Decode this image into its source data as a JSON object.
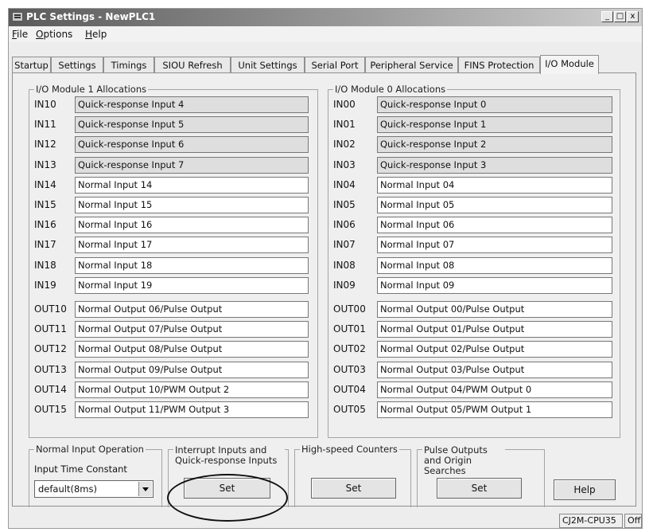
{
  "window": {
    "title": "PLC Settings - NewPLC1"
  },
  "menu": [
    "File",
    "Options",
    "Help"
  ],
  "tabs": [
    "Startup",
    "Settings",
    "Timings",
    "SIOU Refresh",
    "Unit Settings",
    "Serial Port",
    "Peripheral Service",
    "FINS Protection",
    "I/O Module"
  ],
  "module1": {
    "title": "I/O Module 1 Allocations",
    "inputs": [
      {
        "label": "IN10",
        "value": "Quick-response Input 4"
      },
      {
        "label": "IN11",
        "value": "Quick-response Input 5"
      },
      {
        "label": "IN12",
        "value": "Quick-response Input 6"
      },
      {
        "label": "IN13",
        "value": "Quick-response Input 7"
      },
      {
        "label": "IN14",
        "value": "Normal Input 14"
      },
      {
        "label": "IN15",
        "value": "Normal Input 15"
      },
      {
        "label": "IN16",
        "value": "Normal Input 16"
      },
      {
        "label": "IN17",
        "value": "Normal Input 17"
      },
      {
        "label": "IN18",
        "value": "Normal Input 18"
      },
      {
        "label": "IN19",
        "value": "Normal Input 19"
      }
    ],
    "outputs": [
      {
        "label": "OUT10",
        "value": "Normal Output 06/Pulse Output"
      },
      {
        "label": "OUT11",
        "value": "Normal Output 07/Pulse Output"
      },
      {
        "label": "OUT12",
        "value": "Normal Output 08/Pulse Output"
      },
      {
        "label": "OUT13",
        "value": "Normal Output 09/Pulse Output"
      },
      {
        "label": "OUT14",
        "value": "Normal Output 10/PWM Output 2"
      },
      {
        "label": "OUT15",
        "value": "Normal Output 11/PWM Output 3"
      }
    ]
  },
  "module0": {
    "title": "I/O Module 0 Allocations",
    "inputs": [
      {
        "label": "IN00",
        "value": "Quick-response Input 0"
      },
      {
        "label": "IN01",
        "value": "Quick-response Input 1"
      },
      {
        "label": "IN02",
        "value": "Quick-response Input 2"
      },
      {
        "label": "IN03",
        "value": "Quick-response Input 3"
      },
      {
        "label": "IN04",
        "value": "Normal Input 04"
      },
      {
        "label": "IN05",
        "value": "Normal Input 05"
      },
      {
        "label": "IN06",
        "value": "Normal Input 06"
      },
      {
        "label": "IN07",
        "value": "Normal Input 07"
      },
      {
        "label": "IN08",
        "value": "Normal Input 08"
      },
      {
        "label": "IN09",
        "value": "Normal Input 09"
      }
    ],
    "outputs": [
      {
        "label": "OUT00",
        "value": "Normal Output 00/Pulse Output"
      },
      {
        "label": "OUT01",
        "value": "Normal Output 01/Pulse Output"
      },
      {
        "label": "OUT02",
        "value": "Normal Output 02/Pulse Output"
      },
      {
        "label": "OUT03",
        "value": "Normal Output 03/Pulse Output"
      },
      {
        "label": "OUT04",
        "value": "Normal Output 04/PWM Output 0"
      },
      {
        "label": "OUT05",
        "value": "Normal Output 05/PWM Output 1"
      }
    ]
  },
  "normal_input": {
    "title": "Normal Input Operation",
    "label": "Input Time Constant",
    "selected": "default(8ms)"
  },
  "interrupt": {
    "title": "Interrupt Inputs and Quick-response Inputs",
    "button": "Set"
  },
  "counters": {
    "title": "High-speed Counters",
    "button": "Set"
  },
  "pulse": {
    "title": "Pulse Outputs and Origin Searches",
    "button": "Set"
  },
  "help_button": "Help",
  "status": {
    "model": "CJ2M-CPU35",
    "mode": "Offline"
  }
}
